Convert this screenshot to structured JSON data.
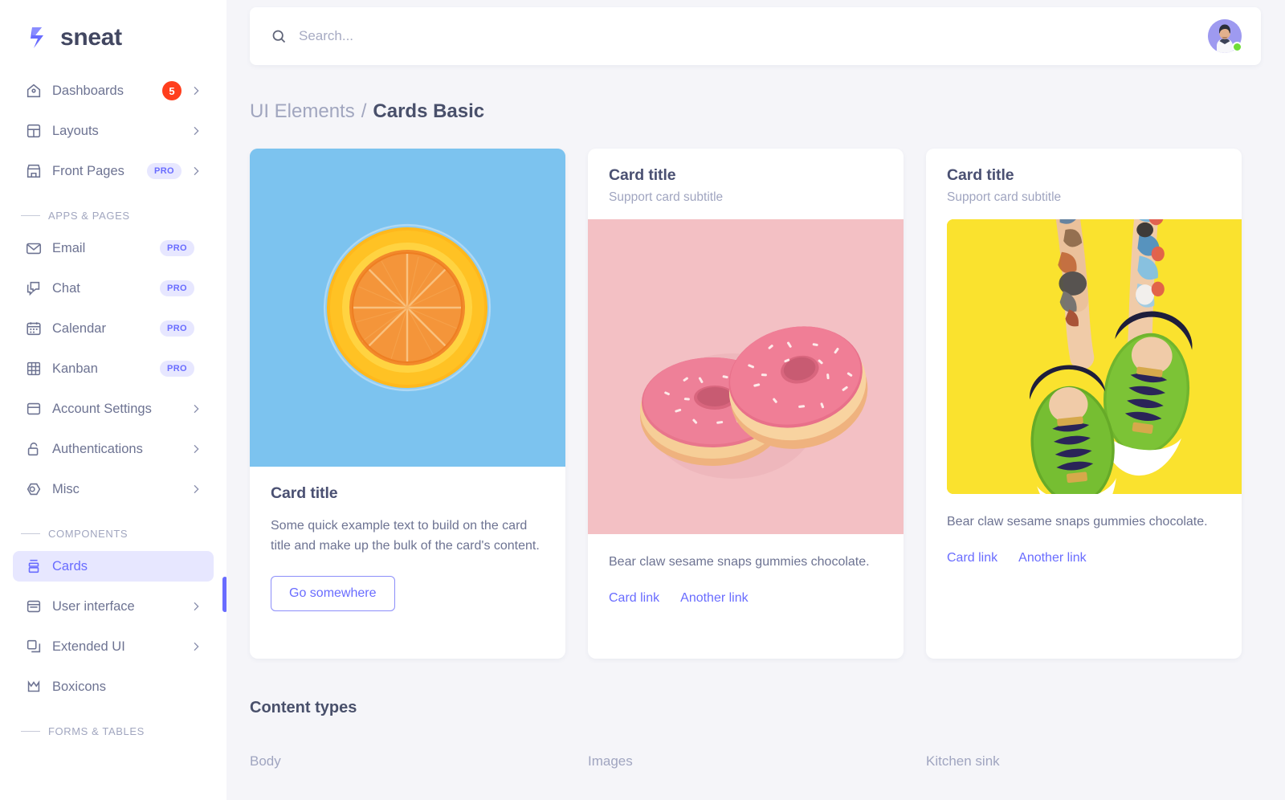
{
  "brand": {
    "name": "sneat",
    "logo_icon": "sneat-logo-icon"
  },
  "sidebar": {
    "groups": [
      {
        "label": null,
        "items": [
          {
            "label": "Dashboards",
            "icon": "home-icon",
            "badge": "5",
            "badge_type": "count",
            "chevron": true,
            "active": false
          },
          {
            "label": "Layouts",
            "icon": "layout-icon",
            "badge": null,
            "badge_type": null,
            "chevron": true,
            "active": false
          },
          {
            "label": "Front Pages",
            "icon": "store-icon",
            "badge": "PRO",
            "badge_type": "pro",
            "chevron": true,
            "active": false
          }
        ]
      },
      {
        "label": "APPS & PAGES",
        "items": [
          {
            "label": "Email",
            "icon": "envelope-icon",
            "badge": "PRO",
            "badge_type": "pro",
            "chevron": false,
            "active": false
          },
          {
            "label": "Chat",
            "icon": "chat-icon",
            "badge": "PRO",
            "badge_type": "pro",
            "chevron": false,
            "active": false
          },
          {
            "label": "Calendar",
            "icon": "calendar-icon",
            "badge": "PRO",
            "badge_type": "pro",
            "chevron": false,
            "active": false
          },
          {
            "label": "Kanban",
            "icon": "grid-icon",
            "badge": "PRO",
            "badge_type": "pro",
            "chevron": false,
            "active": false
          },
          {
            "label": "Account Settings",
            "icon": "window-icon",
            "badge": null,
            "badge_type": null,
            "chevron": true,
            "active": false
          },
          {
            "label": "Authentications",
            "icon": "lock-icon",
            "badge": null,
            "badge_type": null,
            "chevron": true,
            "active": false
          },
          {
            "label": "Misc",
            "icon": "hexagon-icon",
            "badge": null,
            "badge_type": null,
            "chevron": true,
            "active": false
          }
        ]
      },
      {
        "label": "COMPONENTS",
        "items": [
          {
            "label": "Cards",
            "icon": "cards-icon",
            "badge": null,
            "badge_type": null,
            "chevron": false,
            "active": true
          },
          {
            "label": "User interface",
            "icon": "ui-icon",
            "badge": null,
            "badge_type": null,
            "chevron": true,
            "active": false
          },
          {
            "label": "Extended UI",
            "icon": "copy-icon",
            "badge": null,
            "badge_type": null,
            "chevron": true,
            "active": false
          },
          {
            "label": "Boxicons",
            "icon": "crown-icon",
            "badge": null,
            "badge_type": null,
            "chevron": false,
            "active": false
          }
        ]
      },
      {
        "label": "FORMS & TABLES",
        "items": []
      }
    ]
  },
  "topbar": {
    "search": {
      "placeholder": "Search...",
      "value": "",
      "icon": "search-icon"
    },
    "avatar": {
      "name": "avatar",
      "status": "online",
      "status_color": "#71DD37",
      "bg_color": "#9E9AF0"
    }
  },
  "breadcrumb": {
    "parent": "UI Elements",
    "separator": "/",
    "current": "Cards Basic"
  },
  "cards": [
    {
      "id": "card-orange",
      "title": "Card title",
      "subtitle": null,
      "text": "Some quick example text to build on the card title and make up the bulk of the card's content.",
      "image": {
        "name": "orange-slice-photo",
        "bg": "#7CC3EF",
        "position": "top",
        "inset": false
      },
      "button": "Go somewhere",
      "links": []
    },
    {
      "id": "card-donuts",
      "title": "Card title",
      "subtitle": "Support card subtitle",
      "text": "Bear claw sesame snaps gummies chocolate.",
      "image": {
        "name": "pink-donuts-photo",
        "bg": "#F3C0C4",
        "position": "middle",
        "inset": false
      },
      "button": null,
      "links": [
        "Card link",
        "Another link"
      ]
    },
    {
      "id": "card-sneakers",
      "title": "Card title",
      "subtitle": "Support card subtitle",
      "text": "Bear claw sesame snaps gummies chocolate.",
      "image": {
        "name": "green-sneakers-photo",
        "bg": "#FAE22E",
        "position": "middle",
        "inset": true
      },
      "button": null,
      "links": [
        "Card link",
        "Another link"
      ]
    }
  ],
  "content_types": {
    "title": "Content types",
    "columns": [
      "Body",
      "Images",
      "Kitchen sink"
    ]
  },
  "colors": {
    "accent": "#696CFF",
    "accent_soft": "#E7E7FF",
    "danger": "#FF3E1D",
    "success": "#71DD37",
    "page_bg": "#F5F5F9",
    "text_muted": "#6D7392",
    "text_heading": "#49506B"
  }
}
